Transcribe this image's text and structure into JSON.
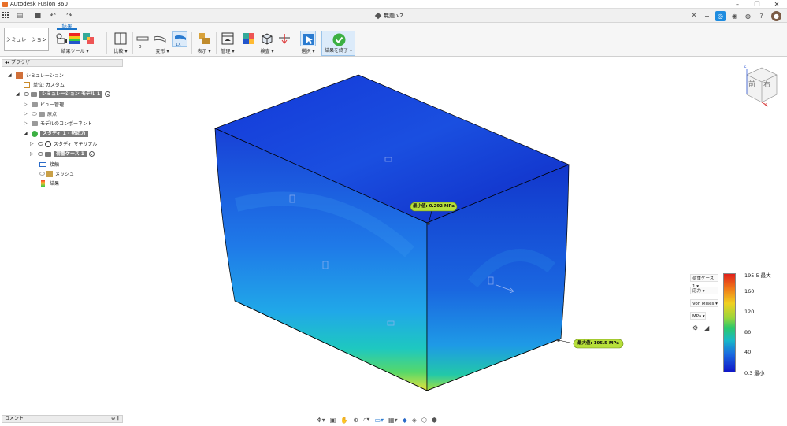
{
  "app": {
    "title": "Autodesk Fusion 360"
  },
  "document": {
    "title": "無題 v2"
  },
  "window_controls": {
    "minimize": "–",
    "restore": "❐",
    "close": "✕"
  },
  "workspace": {
    "label": "シミュレーション ▾"
  },
  "ribbon": {
    "active_tab": "結果",
    "groups": [
      {
        "label": "結果ツール ▾"
      },
      {
        "label": "比較 ▾"
      },
      {
        "label": "変形 ▾"
      },
      {
        "label": "表示 ▾"
      },
      {
        "label": "管理 ▾"
      },
      {
        "label": "検査 ▾"
      },
      {
        "label": "選択 ▾"
      },
      {
        "label": "結果を終了 ▾"
      }
    ],
    "deform_value": "0",
    "deform_scale": "1X"
  },
  "browser": {
    "header": "ブラウザ",
    "items": [
      {
        "label": "シミュレーション"
      },
      {
        "label": "単位: カスタム"
      },
      {
        "label": "シミュレーション モデル 1"
      },
      {
        "label": "ビュー管理"
      },
      {
        "label": "原点"
      },
      {
        "label": "モデルのコンポーネント"
      },
      {
        "label": "スタディ 1 - 熱応力"
      },
      {
        "label": "スタディ マテリアル"
      },
      {
        "label": "荷重ケース 1"
      },
      {
        "label": "接触"
      },
      {
        "label": "メッシュ"
      },
      {
        "label": "結果"
      }
    ]
  },
  "comments": {
    "label": "コメント"
  },
  "viewcube": {
    "front": "前",
    "right": "右",
    "axis_z": "Z",
    "axis_x": "X"
  },
  "probes": {
    "min": "最小値: 0.292 MPa",
    "max": "最大値: 195.5 MPa"
  },
  "legend": {
    "load_case": "荷重ケース 1 ▾",
    "result_type": "応力 ▾",
    "criterion": "Von Mises ▾",
    "unit": "MPa ▾",
    "ticks": [
      "195.5 最大",
      "160",
      "120",
      "80",
      "40",
      "0.3 最小"
    ],
    "colors": {
      "max": "#e0201a",
      "mid": "#2cc86a",
      "min": "#1016c8"
    }
  },
  "navbar": {
    "icons": [
      "orbit-icon",
      "look-at-icon",
      "pan-icon",
      "zoom-fit-icon",
      "zoom-icon",
      "display-mode-icon",
      "grid-icon",
      "view-icon"
    ]
  }
}
